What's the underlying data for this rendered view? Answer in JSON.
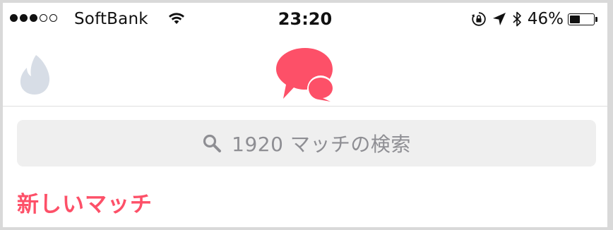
{
  "status_bar": {
    "carrier": "SoftBank",
    "time": "23:20",
    "battery_percent": "46%",
    "battery_level": 0.46,
    "signal_bars_filled": 3,
    "signal_bars_total": 5,
    "icons": [
      "wifi-icon",
      "rotation-lock-icon",
      "location-arrow-icon",
      "bluetooth-icon",
      "battery-icon"
    ]
  },
  "nav": {
    "left_icon": "tinder-flame-icon",
    "center_icon": "chat-bubbles-icon",
    "accent_color": "#fd5068",
    "inactive_color": "#d7dde6"
  },
  "search": {
    "placeholder": "1920 マッチの検索",
    "icon": "search-icon"
  },
  "section": {
    "title": "新しいマッチ"
  }
}
